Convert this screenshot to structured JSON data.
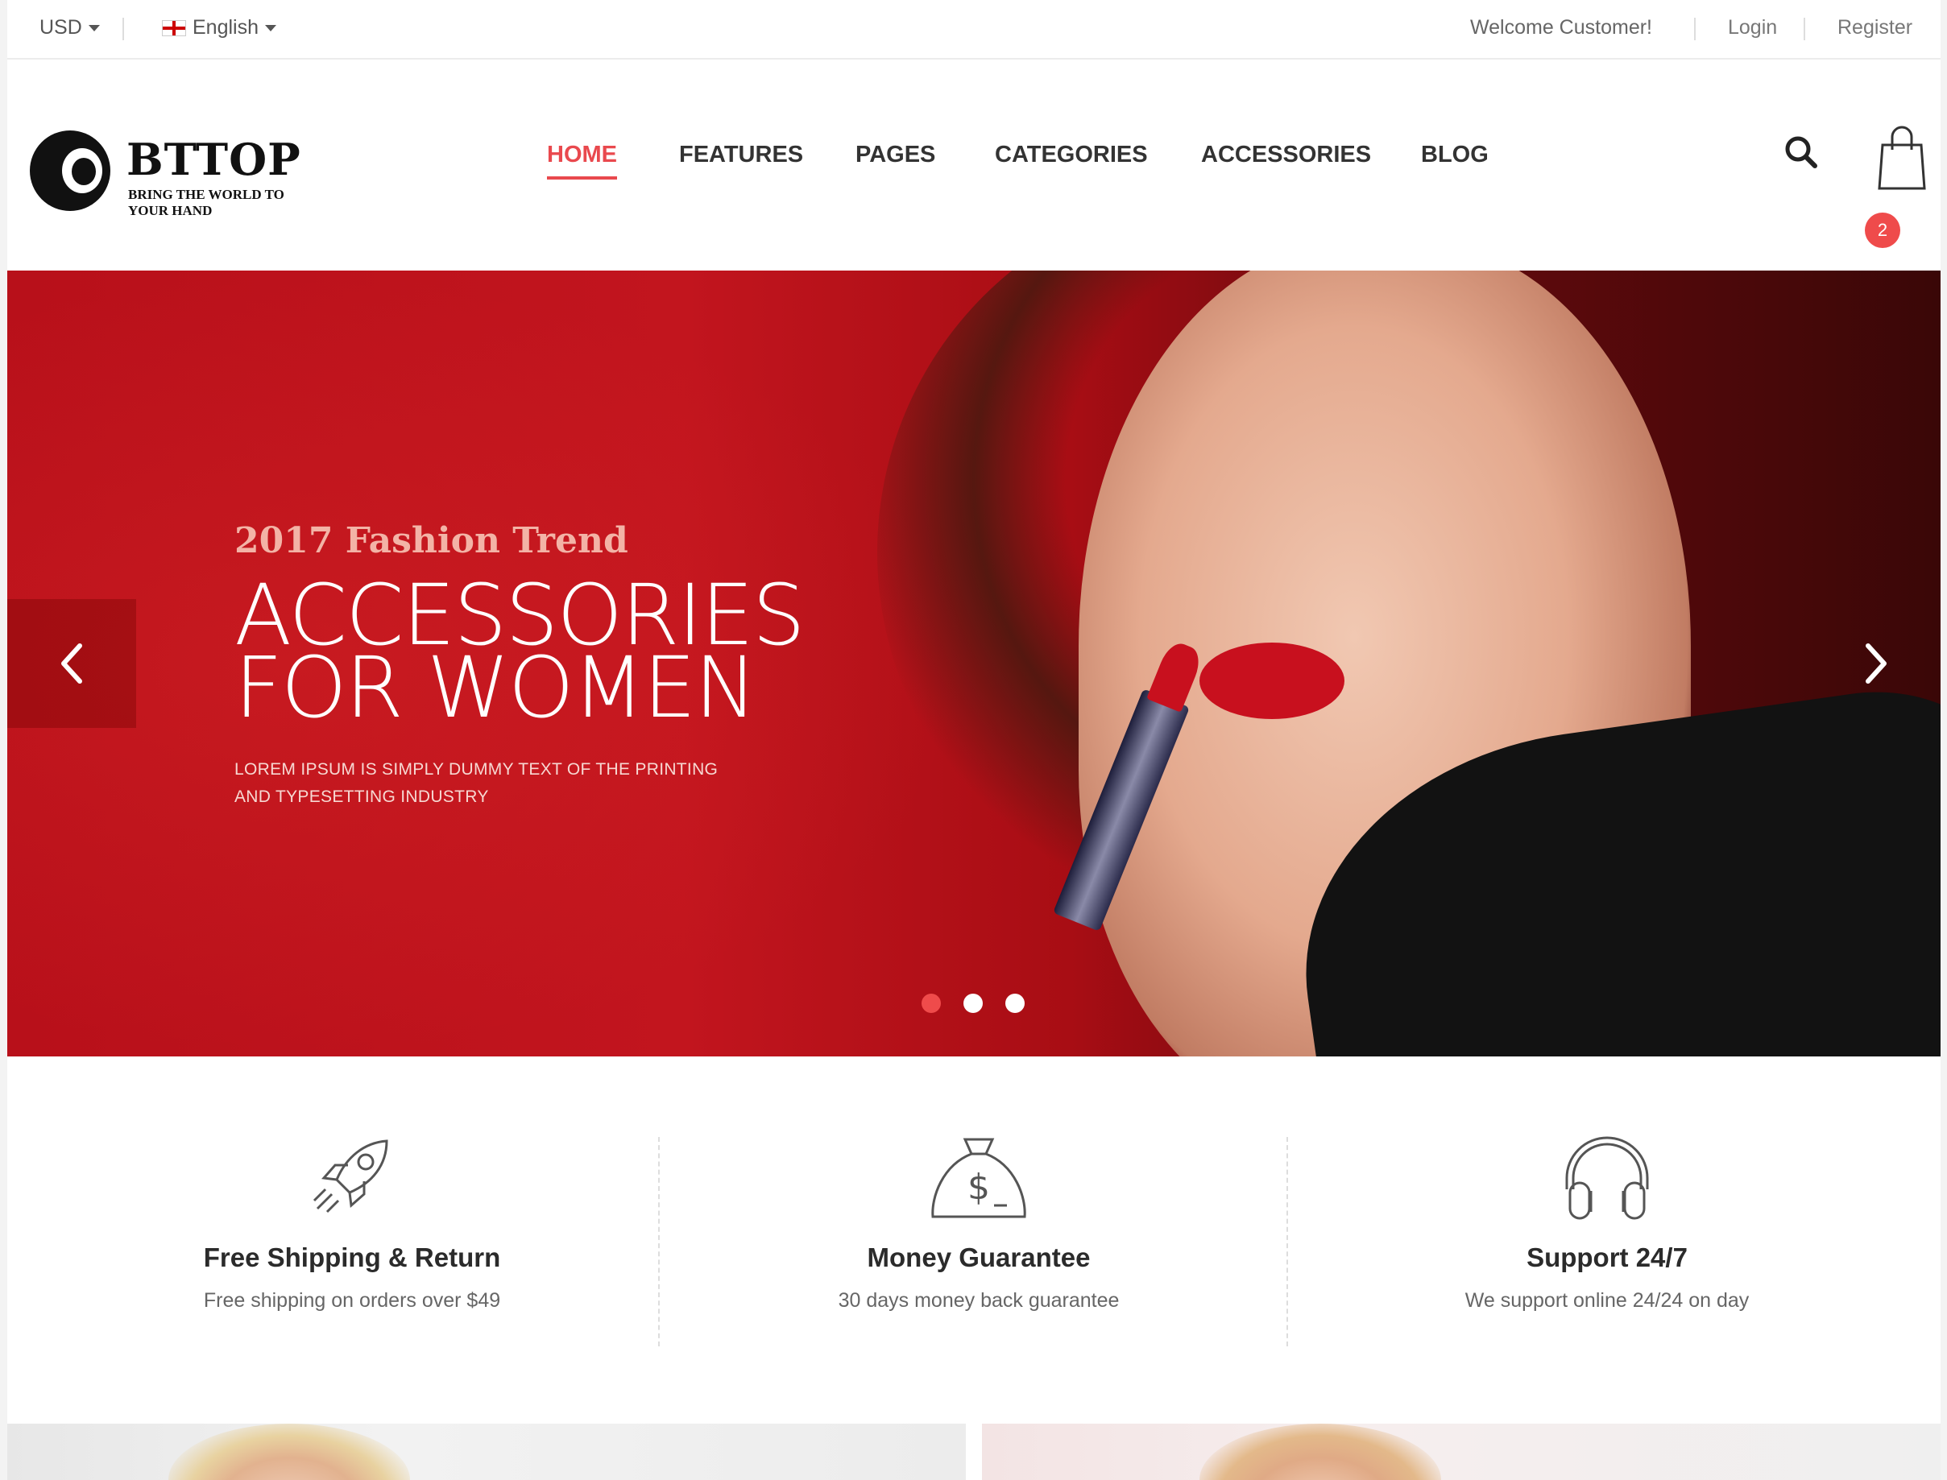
{
  "topbar": {
    "currency": "USD",
    "language": "English",
    "welcome": "Welcome Customer!",
    "login": "Login",
    "register": "Register"
  },
  "logo": {
    "title": "BTTOP",
    "tagline": "BRING THE WORLD TO YOUR HAND"
  },
  "nav": {
    "items": [
      {
        "label": "HOME",
        "active": true
      },
      {
        "label": "FEATURES"
      },
      {
        "label": "PAGES"
      },
      {
        "label": "CATEGORIES"
      },
      {
        "label": "ACCESSORIES"
      },
      {
        "label": "BLOG"
      }
    ]
  },
  "cart": {
    "count": "2"
  },
  "hero": {
    "eyebrow": "2017 Fashion Trend",
    "title_line1": "ACCESSORIES",
    "title_line2": "FOR WOMEN",
    "subtitle_line1": "LOREM IPSUM IS SIMPLY DUMMY TEXT OF THE PRINTING",
    "subtitle_line2": "AND TYPESETTING INDUSTRY",
    "slides": 3,
    "active_slide": 1
  },
  "features": [
    {
      "icon": "rocket-icon",
      "title": "Free Shipping & Return",
      "desc": "Free shipping on orders over $49"
    },
    {
      "icon": "money-bag-icon",
      "title": "Money Guarantee",
      "desc": "30 days money back guarantee"
    },
    {
      "icon": "headphones-icon",
      "title": "Support 24/7",
      "desc": "We support online 24/24 on day"
    }
  ],
  "colors": {
    "accent": "#e9494e",
    "badge": "#ef4b4b",
    "text": "#333333"
  }
}
